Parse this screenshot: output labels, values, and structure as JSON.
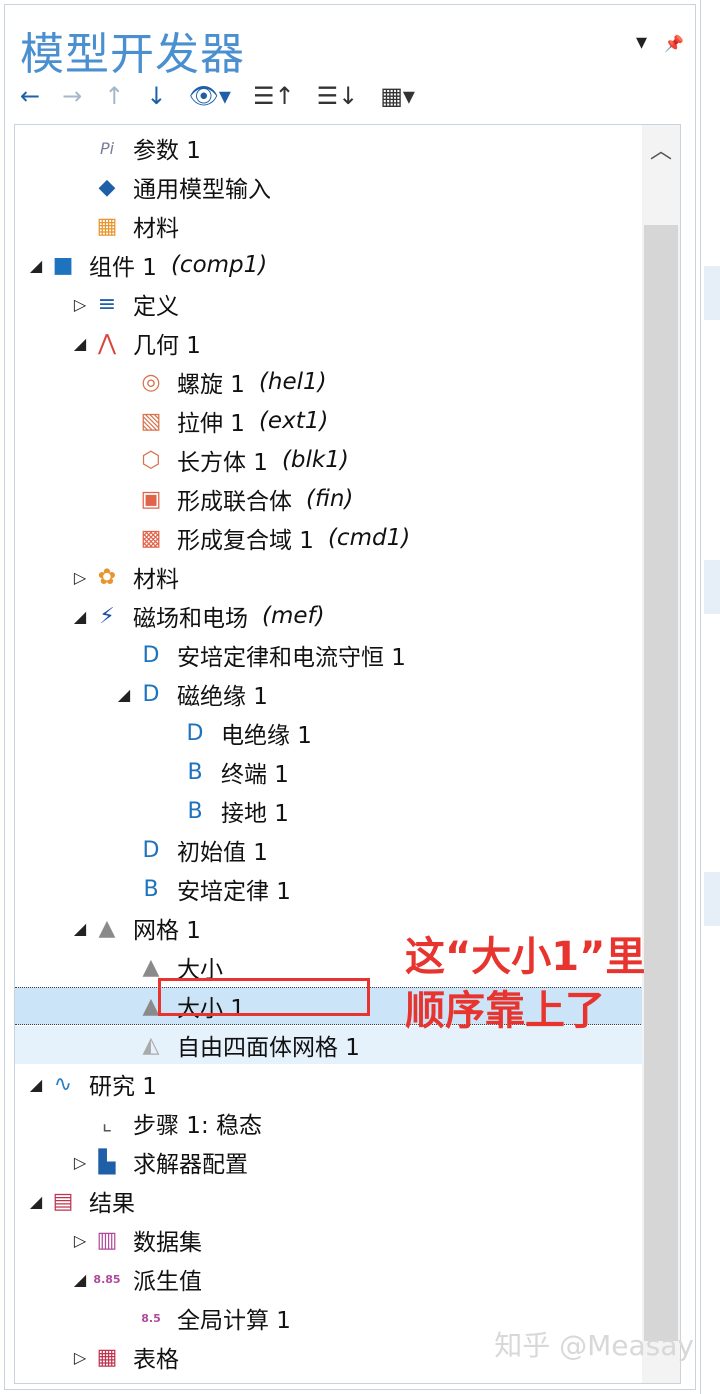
{
  "panel": {
    "title": "模型开发器"
  },
  "title_tools": {
    "dropdown": "▾",
    "pin": "📌"
  },
  "toolbar": [
    {
      "name": "back-button",
      "glyph": "←"
    },
    {
      "name": "forward-button",
      "glyph": "→"
    },
    {
      "name": "move-up-button",
      "glyph": "↑"
    },
    {
      "name": "move-down-button",
      "glyph": "↓"
    },
    {
      "name": "show-button",
      "glyph": "👁▾"
    },
    {
      "name": "collapse-all-button",
      "glyph": "☰↑"
    },
    {
      "name": "expand-all-button",
      "glyph": "☰↓"
    },
    {
      "name": "view-options-button",
      "glyph": "▦▾"
    }
  ],
  "tree": [
    {
      "label": "参数 1",
      "tag": "",
      "exp": "",
      "icon": "Pi"
    },
    {
      "label": "通用模型输入",
      "tag": "",
      "exp": "",
      "icon": "◆"
    },
    {
      "label": "材料",
      "tag": "",
      "exp": "",
      "icon": "▦"
    },
    {
      "label": "组件 1",
      "tag": "(comp1)",
      "exp": "◢",
      "icon": "■"
    },
    {
      "label": "定义",
      "tag": "",
      "exp": "▷",
      "icon": "≡"
    },
    {
      "label": "几何 1",
      "tag": "",
      "exp": "◢",
      "icon": "⋀"
    },
    {
      "label": "螺旋 1",
      "tag": "(hel1)",
      "exp": "",
      "icon": "◎"
    },
    {
      "label": "拉伸 1",
      "tag": "(ext1)",
      "exp": "",
      "icon": "▧"
    },
    {
      "label": "长方体 1",
      "tag": "(blk1)",
      "exp": "",
      "icon": "⬡"
    },
    {
      "label": "形成联合体",
      "tag": "(fin)",
      "exp": "",
      "icon": "▣"
    },
    {
      "label": "形成复合域 1",
      "tag": "(cmd1)",
      "exp": "",
      "icon": "▩"
    },
    {
      "label": "材料",
      "tag": "",
      "exp": "▷",
      "icon": "✿"
    },
    {
      "label": "磁场和电场",
      "tag": "(mef)",
      "exp": "◢",
      "icon": "⚡"
    },
    {
      "label": "安培定律和电流守恒 1",
      "tag": "",
      "exp": "",
      "icon": "D"
    },
    {
      "label": "磁绝缘 1",
      "tag": "",
      "exp": "◢",
      "icon": "D"
    },
    {
      "label": "电绝缘 1",
      "tag": "",
      "exp": "",
      "icon": "D"
    },
    {
      "label": "终端 1",
      "tag": "",
      "exp": "",
      "icon": "B"
    },
    {
      "label": "接地 1",
      "tag": "",
      "exp": "",
      "icon": "B"
    },
    {
      "label": "初始值 1",
      "tag": "",
      "exp": "",
      "icon": "D"
    },
    {
      "label": "安培定律 1",
      "tag": "",
      "exp": "",
      "icon": "B"
    },
    {
      "label": "网格 1",
      "tag": "",
      "exp": "◢",
      "icon": "▲"
    },
    {
      "label": "大小",
      "tag": "",
      "exp": "",
      "icon": "▲"
    },
    {
      "label": "大小 1",
      "tag": "",
      "exp": "",
      "icon": "▲"
    },
    {
      "label": "自由四面体网格 1",
      "tag": "",
      "exp": "",
      "icon": "◭"
    },
    {
      "label": "研究 1",
      "tag": "",
      "exp": "◢",
      "icon": "∿"
    },
    {
      "label": "步骤 1: 稳态",
      "tag": "",
      "exp": "",
      "icon": "⌞"
    },
    {
      "label": "求解器配置",
      "tag": "",
      "exp": "▷",
      "icon": "▙"
    },
    {
      "label": "结果",
      "tag": "",
      "exp": "◢",
      "icon": "▤"
    },
    {
      "label": "数据集",
      "tag": "",
      "exp": "▷",
      "icon": "▥"
    },
    {
      "label": "派生值",
      "tag": "",
      "exp": "◢",
      "icon": "8.85"
    },
    {
      "label": "全局计算 1",
      "tag": "",
      "exp": "",
      "icon": "8.5"
    },
    {
      "label": "表格",
      "tag": "",
      "exp": "▷",
      "icon": "▦"
    }
  ],
  "annotation": {
    "line1": "这“大小1”里",
    "line2": "顺序靠上了"
  },
  "watermark": "知乎 @Measay",
  "scrollbar": {
    "up": "︿"
  },
  "colors": {
    "title": "#4a8fd0",
    "annotation": "#e8342e",
    "selection": "#cce4f7"
  }
}
